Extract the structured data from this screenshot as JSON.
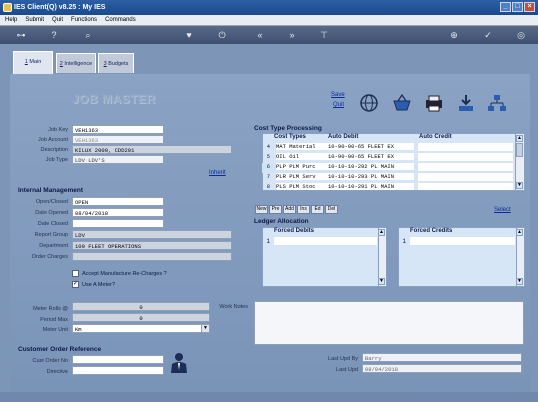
{
  "window": {
    "title": "IES Client(Q) v8.25 : My IES"
  },
  "menu": [
    "Help",
    "Submit",
    "Quit",
    "Functions",
    "Commands"
  ],
  "tabs": [
    {
      "num": "1",
      "label": "Main"
    },
    {
      "num": "2",
      "label": "Intelligence"
    },
    {
      "num": "3",
      "label": "Budgets"
    }
  ],
  "header": {
    "title": "JOB MASTER",
    "save_label": "Save",
    "quit_label": "Quit"
  },
  "job": {
    "key_label": "Job Key",
    "key": "VEH1363",
    "account_label": "Job Account",
    "account": "VEH1363",
    "description_label": "Description",
    "description": "KILUX 2000, CDD201",
    "type_label": "Job Type",
    "type": "LDV LDV'S",
    "inherit_label": "Inherit"
  },
  "internal": {
    "heading": "Internal Management",
    "open_closed_label": "Open/Closed",
    "open_closed": "OPEN",
    "date_opened_label": "Date Opened",
    "date_opened": "08/04/2018",
    "date_closed_label": "Date Closed",
    "date_closed": "",
    "report_group_label": "Report Group",
    "report_group": "LDV",
    "department_label": "Department",
    "department": "109 FLEET OPERATIONS",
    "order_charges_label": "Order Charges",
    "order_charges": "",
    "accept_manufacture_label": "Accept Manufacture Re-Charges ?",
    "accept_manufacture": false,
    "use_meter_label": "Use A Meter?",
    "use_meter": true,
    "meter_rolls_label": "Meter Rolls @",
    "meter_rolls": "0",
    "period_max_label": "Period Max",
    "period_max": "0",
    "meter_unit_label": "Meter Unit",
    "meter_unit": "Km"
  },
  "cost_types": {
    "heading": "Cost Type Processing",
    "columns": [
      "Cost Types",
      "Auto Debit",
      "Auto Credit"
    ],
    "rows": [
      {
        "num": "4",
        "type": "MAT Material",
        "debit": "10-90-00-65 FLEET EX",
        "credit": ""
      },
      {
        "num": "5",
        "type": "OIL Oil",
        "debit": "10-90-00-65 FLEET EX",
        "credit": ""
      },
      {
        "num": "6",
        "type": "PLP PLM Purc",
        "debit": "10-10-10-292 PL MAIN",
        "credit": ""
      },
      {
        "num": "7",
        "type": "PLR PLM Serv",
        "debit": "10-10-10-293 PL MAIN",
        "credit": ""
      },
      {
        "num": "8",
        "type": "PLS PLM Stoc",
        "debit": "10-10-10-291 PL MAIN",
        "credit": ""
      }
    ],
    "buttons": [
      "New",
      "Pre",
      "Add",
      "Ins",
      "Ed",
      "Del"
    ],
    "select_label": "Select"
  },
  "ledger": {
    "heading": "Ledger Allocation",
    "debits_label": "Forced Debits",
    "credits_label": "Forced Credits",
    "debit_row_num": "1",
    "credit_row_num": "1"
  },
  "work_notes_label": "Work Notes",
  "customer": {
    "heading": "Customer Order Reference",
    "order_no_label": "Cust Order No",
    "order_no": "",
    "directive_label": "Directive",
    "directive": ""
  },
  "audit": {
    "last_upd_by_label": "Last Upd By",
    "last_upd_by": "Barry",
    "last_upd_label": "Last Upd",
    "last_upd": "08/04/2018"
  },
  "colors": {
    "accent": "#1a4a8c",
    "panel": "#7d96b8",
    "grid": "#d7e6f7"
  }
}
